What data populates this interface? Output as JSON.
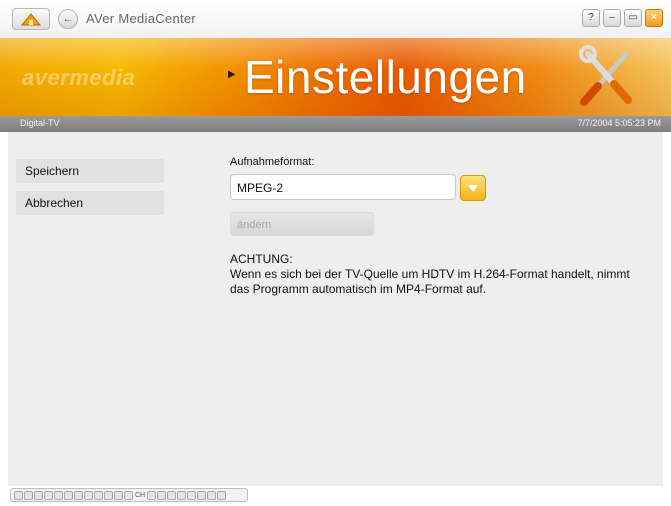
{
  "window": {
    "app_title": "AVer MediaCenter",
    "buttons": {
      "help": "?",
      "minimize": "–",
      "restore": "▭",
      "close": "×"
    }
  },
  "banner": {
    "brand": "avermedia",
    "section_title": "Einstellungen"
  },
  "status": {
    "source": "Digital-TV",
    "datetime": "7/7/2004 5:05:23 PM"
  },
  "sidebar": {
    "save_label": "Speichern",
    "cancel_label": "Abbrechen"
  },
  "form": {
    "format_label": "Aufnahmeformat:",
    "format_value": "MPEG-2",
    "change_label": "ändern"
  },
  "notice": {
    "title": "ACHTUNG:",
    "text": "Wenn es sich bei der TV-Quelle um HDTV im H.264-Format handelt, nimmt das Programm automatisch im MP4-Format auf."
  },
  "controls": {
    "ch_label": "CH"
  },
  "colors": {
    "banner_orange": "#f07800",
    "accent_yellow": "#f2b418",
    "status_gray": "#8a8a8a"
  },
  "icons": [
    "home-icon",
    "back-arrow-icon",
    "help-icon",
    "minimize-icon",
    "restore-icon",
    "close-icon",
    "tools-icon",
    "dropdown-arrow-icon"
  ]
}
